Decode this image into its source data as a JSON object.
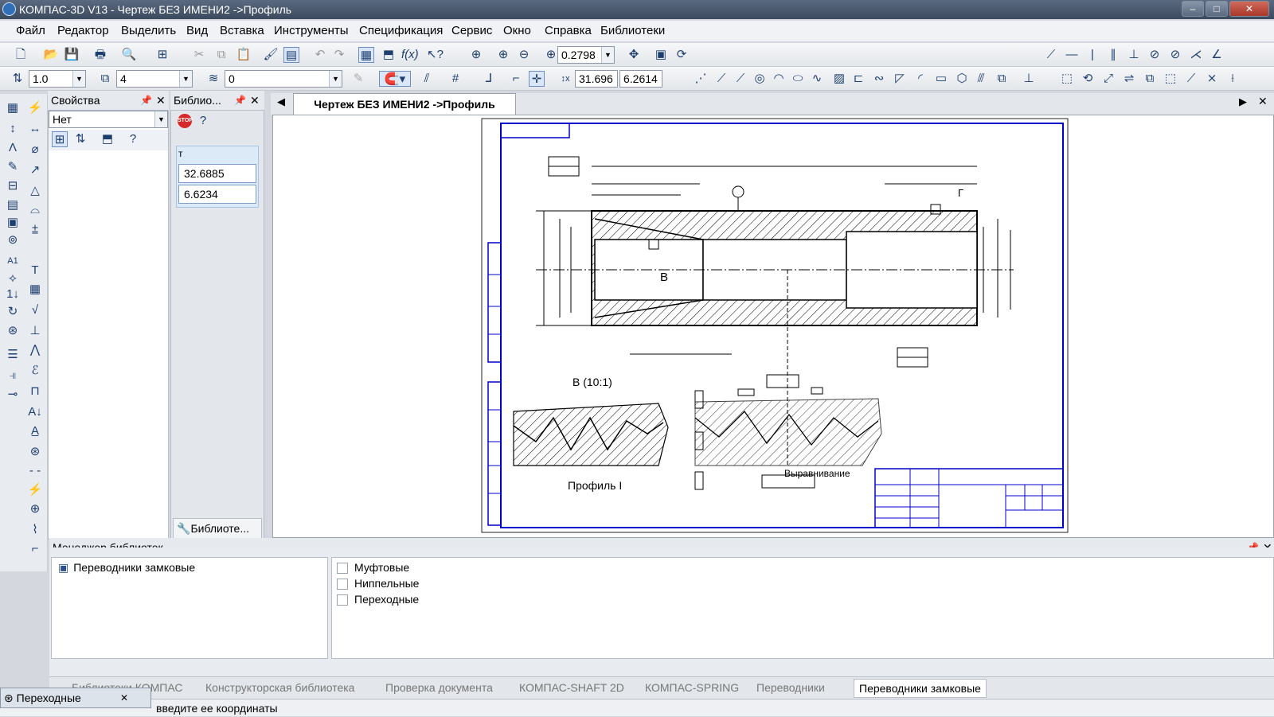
{
  "window": {
    "title": "КОМПАС-3D V13 - Чертеж БЕЗ ИМЕНИ2 ->Профиль",
    "minimize": "–",
    "maximize": "□",
    "close": "✕"
  },
  "menu": [
    "Файл",
    "Редактор",
    "Выделить",
    "Вид",
    "Вставка",
    "Инструменты",
    "Спецификация",
    "Сервис",
    "Окно",
    "Справка",
    "Библиотеки"
  ],
  "toolbar1": {
    "zoom_value": "0.2798"
  },
  "toolbar2": {
    "step_value": "1.0",
    "layer_value": "4",
    "style_value": "0",
    "x_coord": "31.696",
    "y_coord": "6.2614"
  },
  "properties": {
    "title": "Свойства",
    "select_value": "Нет"
  },
  "library_panel": {
    "title": "Библио...",
    "cursor_label": "т",
    "field1": "32.6885",
    "field2": "6.6234",
    "footer_button": "Библиоте..."
  },
  "document_tab": {
    "label": "Чертеж БЕЗ ИМЕНИ2 ->Профиль"
  },
  "drawing": {
    "view_label": "В (10:1)",
    "profile_label": "Профиль I",
    "tooltip": "Выравнивание",
    "label_b": "В",
    "label_g": "Г"
  },
  "library_manager": {
    "title": "Менеджер библиотек",
    "tree_item": "Переводники замковые",
    "items": [
      "Муфтовые",
      "Ниппельные",
      "Переходные"
    ]
  },
  "bottom_tabs": [
    "Библиотеки КОМПАС",
    "Конструкторская библиотека",
    "Проверка документа",
    "КОМПАС-SHAFT 2D",
    "КОМПАС-SPRING",
    "Переводники",
    "Переводники замковые"
  ],
  "floating_window": {
    "label": "Переходные"
  },
  "status": {
    "text": "введите ее координаты"
  }
}
